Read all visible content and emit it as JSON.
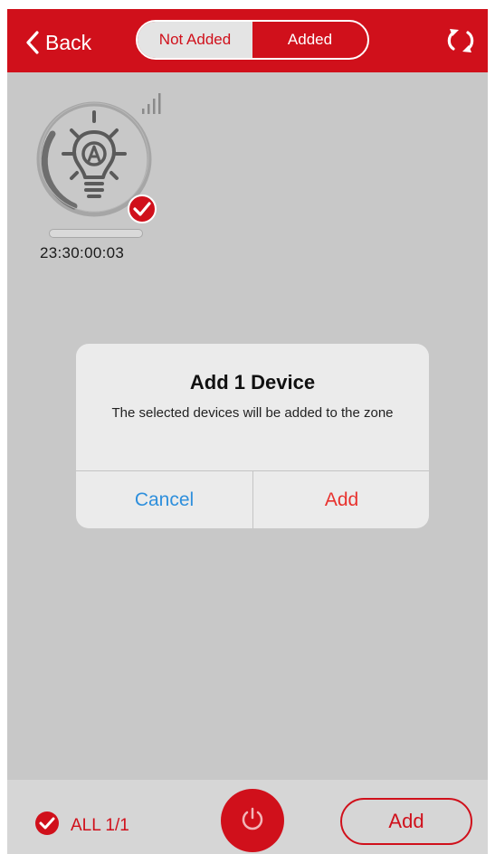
{
  "header": {
    "back_label": "Back",
    "tabs": [
      {
        "label": "Not Added",
        "active": true
      },
      {
        "label": "Added",
        "active": false
      }
    ],
    "refresh_icon": "refresh-icon"
  },
  "device": {
    "icon": "bulb-auto-icon",
    "timer": "23:30:00:03",
    "selected": true,
    "signal_icon": "signal-strength-icon"
  },
  "dialog": {
    "title": "Add 1 Device",
    "message": "The selected devices will be added to the zone",
    "cancel_label": "Cancel",
    "add_label": "Add"
  },
  "footer": {
    "all_label": "ALL 1/1",
    "add_label": "Add",
    "power_icon": "power-icon"
  },
  "colors": {
    "brand_red": "#d0101b",
    "cancel_blue": "#2e8fdc",
    "add_red": "#e8322e",
    "background_gray": "#c8c8c8"
  }
}
